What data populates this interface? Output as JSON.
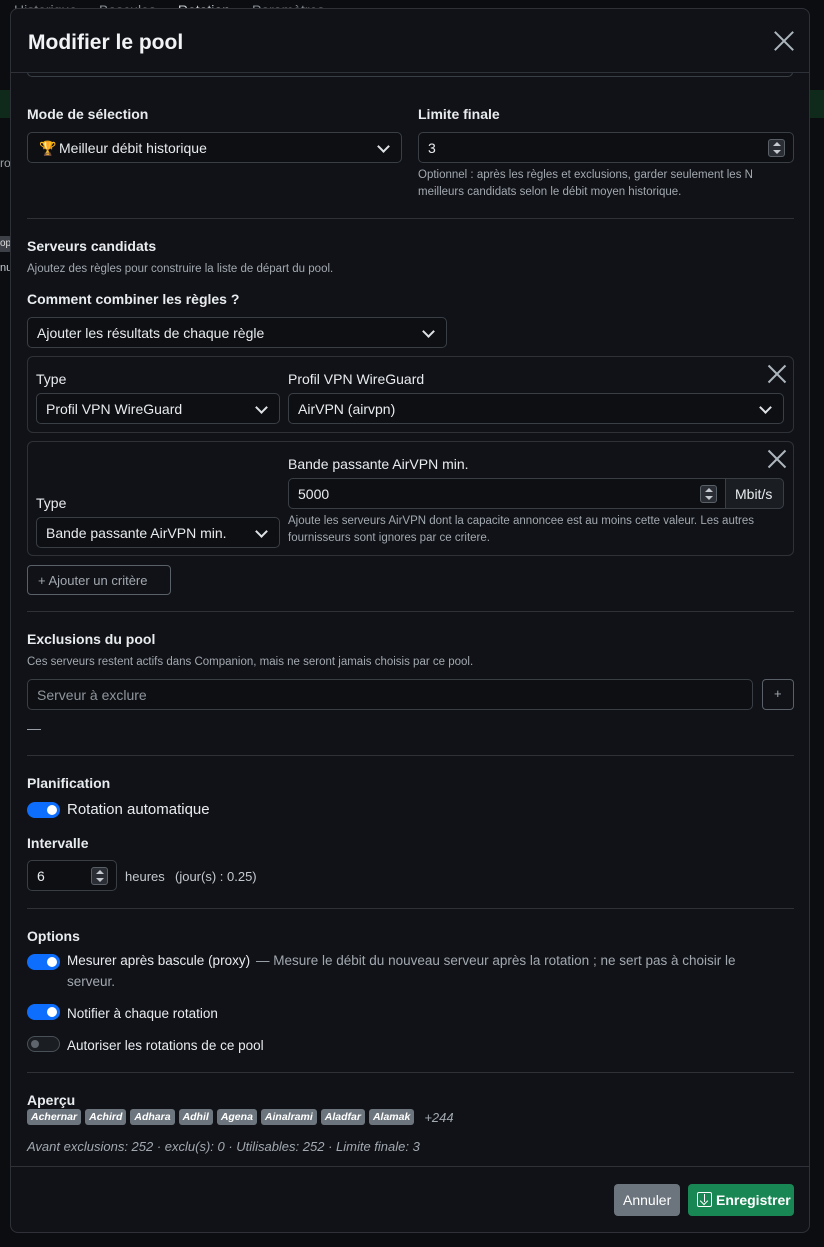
{
  "background": {
    "nav": [
      "Historique",
      "Bascules",
      "Rotation",
      "Paramètres"
    ],
    "side_a": "ro",
    "side_b": "op",
    "side_c": "nu"
  },
  "modal": {
    "title": "Modifier le pool"
  },
  "selection": {
    "mode_label": "Mode de sélection",
    "mode_icon": "🏆",
    "mode_value": "Meilleur débit historique",
    "limit_label": "Limite finale",
    "limit_value": "3",
    "limit_help_1": "Optionnel : après les règles et exclusions, garder seulement les N",
    "limit_help_2": "meilleurs candidats selon le débit moyen historique."
  },
  "candidates": {
    "title": "Serveurs candidats",
    "help": "Ajoutez des règles pour construire la liste de départ du pool.",
    "combine_label": "Comment combiner les règles ?",
    "combine_value": "Ajouter les résultats de chaque règle",
    "rule1": {
      "type_label": "Type",
      "type_value": "Profil VPN WireGuard",
      "profile_label": "Profil VPN WireGuard",
      "profile_value": "AirVPN (airvpn)"
    },
    "rule2": {
      "type_label": "Type",
      "type_value": "Bande passante AirVPN min.",
      "bw_label": "Bande passante AirVPN min.",
      "bw_value": "5000",
      "bw_unit": "Mbit/s",
      "bw_help_1": "Ajoute les serveurs AirVPN dont la capacite annoncee est au moins cette valeur. Les autres",
      "bw_help_2": "fournisseurs sont ignores par ce critere."
    },
    "add_button": "+ Ajouter un critère"
  },
  "exclusions": {
    "title": "Exclusions du pool",
    "help": "Ces serveurs restent actifs dans Companion, mais ne seront jamais choisis par ce pool.",
    "placeholder": "Serveur à exclure",
    "add_button": "+",
    "empty": "—"
  },
  "planning": {
    "title": "Planification",
    "auto_rotation": "Rotation automatique",
    "interval_label": "Intervalle",
    "interval_value": "6",
    "interval_unit": "heures",
    "interval_days": "(jour(s) : 0.25)"
  },
  "options": {
    "title": "Options",
    "measure_label": "Mesurer après bascule (proxy)",
    "measure_help_1": "— Mesure le débit du nouveau serveur après la rotation ; ne sert pas à choisir le",
    "measure_help_2": "serveur.",
    "notify_label": "Notifier à chaque rotation",
    "allow_label": "Autoriser les rotations de ce pool"
  },
  "preview": {
    "title": "Aperçu",
    "servers": [
      "Achernar",
      "Achird",
      "Adhara",
      "Adhil",
      "Agena",
      "Ainalrami",
      "Aladfar",
      "Alamak"
    ],
    "more": "+244",
    "summary": "Avant exclusions: 252 · exclu(s): 0 · Utilisables: 252 · Limite finale: 3"
  },
  "footer": {
    "cancel": "Annuler",
    "save": "Enregistrer"
  },
  "colors": {
    "primary": "#0d6efd",
    "success": "#198754",
    "secondary": "#6c757d"
  }
}
